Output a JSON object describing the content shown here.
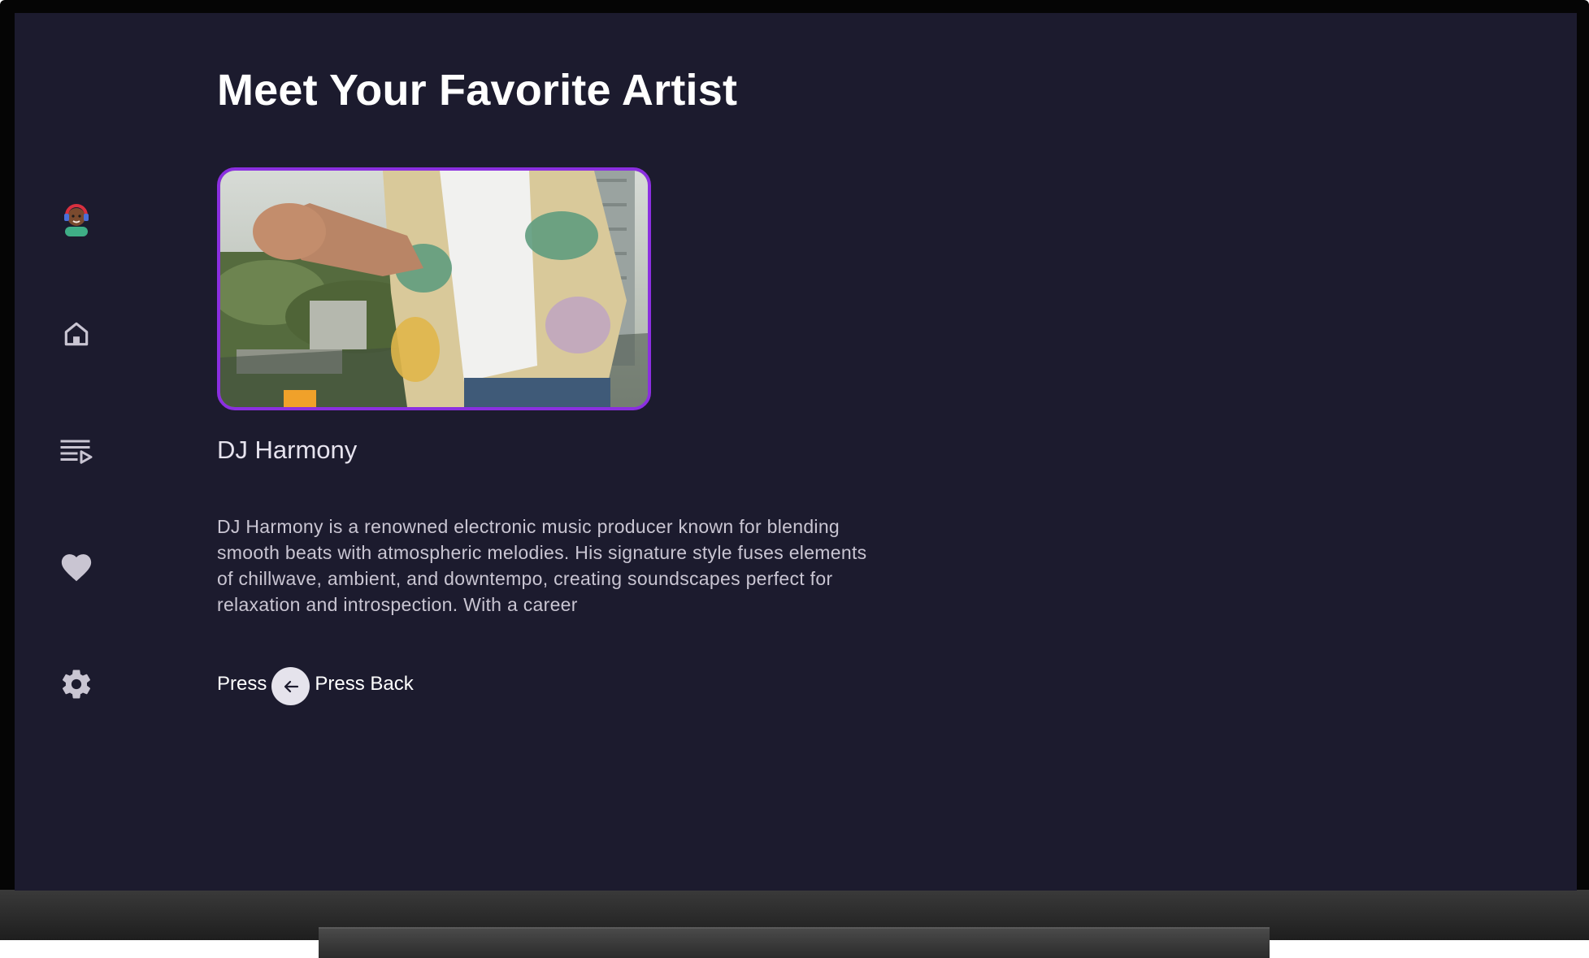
{
  "screen": {
    "background": "#1c1b2e",
    "accent": "#8b2fe0"
  },
  "sidebar": {
    "items": [
      {
        "id": "profile",
        "icon": "avatar-icon"
      },
      {
        "id": "home",
        "icon": "home-icon"
      },
      {
        "id": "playlist",
        "icon": "playlist-play-icon"
      },
      {
        "id": "favorites",
        "icon": "heart-icon"
      },
      {
        "id": "settings",
        "icon": "gear-icon"
      }
    ]
  },
  "main": {
    "title": "Meet Your Favorite Artist",
    "artist": {
      "name": "DJ Harmony",
      "bio": "DJ Harmony is a renowned electronic music producer known for blending smooth beats with atmospheric melodies. His signature style fuses elements of chillwave, ambient, and downtempo, creating soundscapes perfect for relaxation and introspection. With a career"
    },
    "back_hint": {
      "prefix": "Press",
      "icon": "arrow-left-icon",
      "label": "Press Back"
    }
  }
}
